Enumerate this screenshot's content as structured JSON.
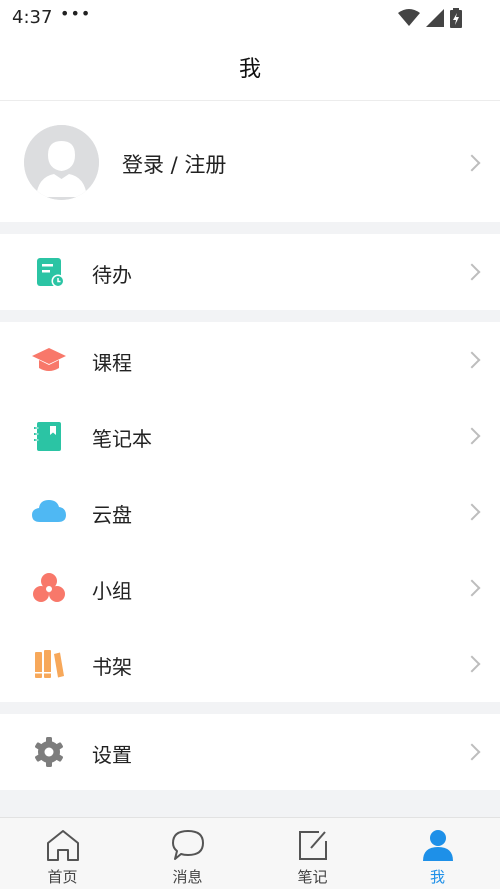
{
  "status_bar": {
    "time": "4:37",
    "dots": "•••"
  },
  "header": {
    "title": "我"
  },
  "profile": {
    "label": "登录 / 注册"
  },
  "menu": {
    "todo": "待办",
    "courses": "课程",
    "notebook": "笔记本",
    "cloud": "云盘",
    "group": "小组",
    "bookshelf": "书架",
    "settings": "设置"
  },
  "bottom_nav": [
    {
      "label": "首页",
      "icon": "home-icon",
      "active": false
    },
    {
      "label": "消息",
      "icon": "message-icon",
      "active": false
    },
    {
      "label": "笔记",
      "icon": "note-edit-icon",
      "active": false
    },
    {
      "label": "我",
      "icon": "user-icon",
      "active": true
    }
  ],
  "colors": {
    "todo": "#2bc4a4",
    "courses": "#f8786a",
    "notebook": "#2bc4a4",
    "cloud": "#4fb8f3",
    "group": "#f8786a",
    "bookshelf": "#f7a85a",
    "settings": "#7d7d7d",
    "active_tab": "#1e90e8"
  }
}
